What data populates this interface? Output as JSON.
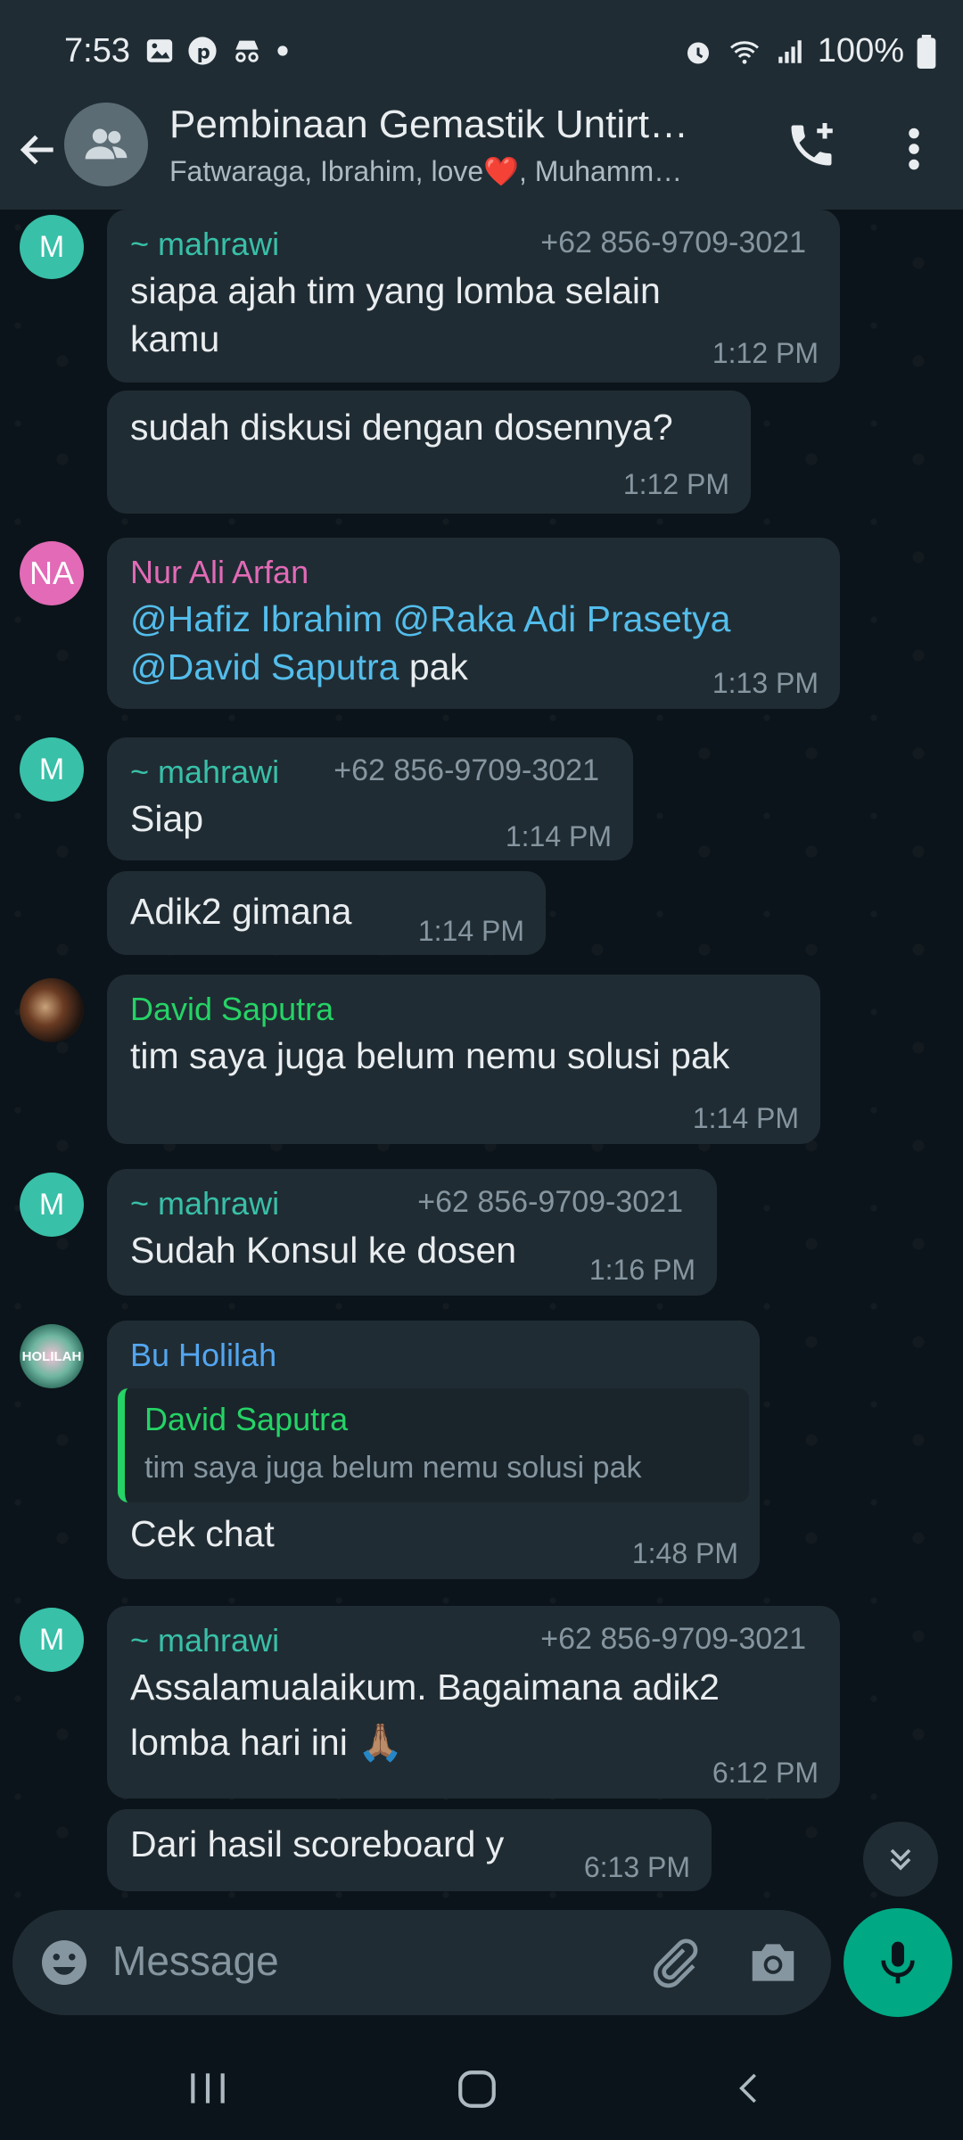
{
  "status_bar": {
    "time": "7:53",
    "battery": "100%"
  },
  "header": {
    "title": "Pembinaan Gemastik Untirt…",
    "subtitle": "Fatwaraga, Ibrahim, love❤️, Muhamm…"
  },
  "messages": [
    {
      "sender": "~ mahrawi",
      "phone": "+62 856-9709-3021",
      "avatar": "M",
      "text": "siapa ajah tim yang lomba selain kamu",
      "time": "1:12 PM"
    },
    {
      "text": "sudah diskusi dengan dosennya?",
      "time": "1:12 PM"
    },
    {
      "sender": "Nur Ali Arfan",
      "avatar": "NA",
      "mention1": "@Hafiz Ibrahim",
      "mention2": "@Raka Adi Prasetya",
      "mention3": "@David Saputra",
      "text_tail": " pak",
      "time": "1:13 PM"
    },
    {
      "sender": "~ mahrawi",
      "phone": "+62 856-9709-3021",
      "avatar": "M",
      "text": "Siap",
      "time": "1:14 PM"
    },
    {
      "text": "Adik2 gimana",
      "time": "1:14 PM"
    },
    {
      "sender": "David Saputra",
      "text": "tim saya juga belum nemu solusi pak",
      "time": "1:14 PM"
    },
    {
      "sender": "~ mahrawi",
      "phone": "+62 856-9709-3021",
      "avatar": "M",
      "text": "Sudah Konsul ke dosen",
      "time": "1:16 PM"
    },
    {
      "sender": "Bu Holilah",
      "avatar_text": "HOLILAH",
      "quote_sender": "David Saputra",
      "quote_text": "tim saya juga belum nemu solusi pak",
      "text": "Cek chat",
      "time": "1:48 PM"
    },
    {
      "sender": "~ mahrawi",
      "phone": "+62 856-9709-3021",
      "avatar": "M",
      "text1": "Assalamualaikum. Bagaimana adik2",
      "text2": "lomba hari ini",
      "emoji": "🙏🏽",
      "time": "6:12 PM"
    },
    {
      "text": "Dari hasil scoreboard y",
      "time": "6:13 PM"
    }
  ],
  "input": {
    "placeholder": "Message"
  },
  "colors": {
    "mahrawi": "#38c0a8",
    "nur_ali": "#e26ab6",
    "david": "#25d366",
    "holilah": "#53a6f0",
    "accent": "#00a884"
  }
}
